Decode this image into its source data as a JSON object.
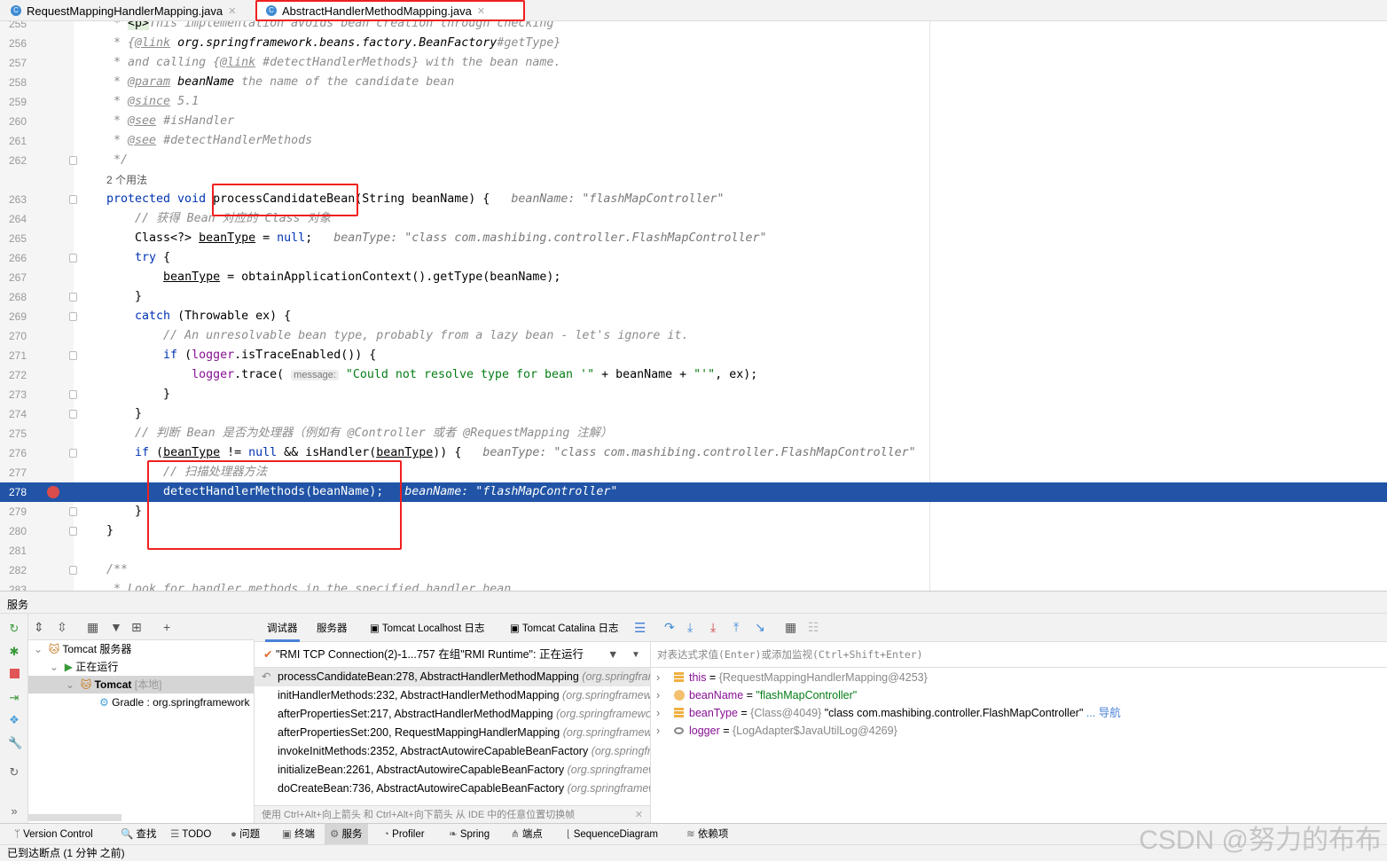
{
  "tabs": [
    {
      "label": "RequestMappingHandlerMapping.java",
      "active": false
    },
    {
      "label": "AbstractHandlerMethodMapping.java",
      "active": true
    }
  ],
  "editor": {
    "usages_hint": "2 个用法",
    "rows": [
      {
        "num": "255",
        "tokens": [
          [
            "cm",
            " * "
          ],
          [
            "green",
            "<p>"
          ],
          [
            "cm",
            "This implementation avoids bean creation through checking"
          ]
        ]
      },
      {
        "num": "256",
        "tokens": [
          [
            "cm",
            " * {"
          ],
          [
            "tag",
            "@link"
          ],
          [
            "dt",
            " org.springframework.beans.factory.BeanFactory"
          ],
          [
            "cm",
            "#getType}"
          ]
        ]
      },
      {
        "num": "257",
        "tokens": [
          [
            "cm",
            " * and calling {"
          ],
          [
            "tag",
            "@link"
          ],
          [
            "cm",
            " #detectHandlerMethods} with the bean name."
          ]
        ]
      },
      {
        "num": "258",
        "tokens": [
          [
            "cm",
            " * "
          ],
          [
            "tag",
            "@param"
          ],
          [
            "dt",
            " beanName"
          ],
          [
            "cm",
            " the name of the candidate bean"
          ]
        ]
      },
      {
        "num": "259",
        "tokens": [
          [
            "cm",
            " * "
          ],
          [
            "tag",
            "@since"
          ],
          [
            "cm",
            " 5.1"
          ]
        ]
      },
      {
        "num": "260",
        "tokens": [
          [
            "cm",
            " * "
          ],
          [
            "tag",
            "@see"
          ],
          [
            "cm",
            " #isHandler"
          ]
        ]
      },
      {
        "num": "261",
        "tokens": [
          [
            "cm",
            " * "
          ],
          [
            "tag",
            "@see"
          ],
          [
            "cm",
            " #detectHandlerMethods"
          ]
        ]
      },
      {
        "num": "262",
        "fold": true,
        "tokens": [
          [
            "cm",
            " */"
          ]
        ]
      },
      {
        "num": "",
        "usages": true,
        "tokens": [
          [
            "lbl",
            "2 个用法"
          ]
        ]
      },
      {
        "num": "263",
        "fold": true,
        "tokens": [
          [
            "kw",
            "protected void "
          ],
          [
            "pl",
            "processCandidateBean(String beanName) {"
          ]
        ],
        "hint": "beanName: \"flashMapController\""
      },
      {
        "num": "264",
        "tokens": [
          [
            "cm",
            "    // 获得 Bean 对应的 Class 对象"
          ]
        ]
      },
      {
        "num": "265",
        "tokens": [
          [
            "pl",
            "    Class<?> "
          ],
          [
            "ul",
            "beanType"
          ],
          [
            "pl",
            " = "
          ],
          [
            "kw",
            "null"
          ],
          [
            "pl",
            ";"
          ]
        ],
        "hint": "beanType: \"class com.mashibing.controller.FlashMapController\""
      },
      {
        "num": "266",
        "fold": true,
        "tokens": [
          [
            "kw",
            "    try"
          ],
          [
            "pl",
            " {"
          ]
        ]
      },
      {
        "num": "267",
        "tokens": [
          [
            "pl",
            "        "
          ],
          [
            "ul",
            "beanType"
          ],
          [
            "pl",
            " = obtainApplicationContext().getType(beanName);"
          ]
        ]
      },
      {
        "num": "268",
        "fold": true,
        "tokens": [
          [
            "pl",
            "    }"
          ]
        ]
      },
      {
        "num": "269",
        "fold": true,
        "tokens": [
          [
            "kw",
            "    catch"
          ],
          [
            "pl",
            " (Throwable ex) {"
          ]
        ]
      },
      {
        "num": "270",
        "tokens": [
          [
            "cm",
            "        // An unresolvable bean type, probably from a lazy bean - let's ignore it."
          ]
        ]
      },
      {
        "num": "271",
        "fold": true,
        "tokens": [
          [
            "kw",
            "        if"
          ],
          [
            "pl",
            " ("
          ],
          [
            "fld",
            "logger"
          ],
          [
            "pl",
            ".isTraceEnabled()) {"
          ]
        ]
      },
      {
        "num": "272",
        "tokens": [
          [
            "pl",
            "            "
          ],
          [
            "fld",
            "logger"
          ],
          [
            "pl",
            ".trace( "
          ],
          [
            "phint",
            "message:"
          ],
          [
            "str",
            " \"Could not resolve type for bean '\""
          ],
          [
            "pl",
            " + beanName + "
          ],
          [
            "str",
            "\"'\""
          ],
          [
            "pl",
            ", ex);"
          ]
        ]
      },
      {
        "num": "273",
        "fold": true,
        "tokens": [
          [
            "pl",
            "        }"
          ]
        ]
      },
      {
        "num": "274",
        "fold": true,
        "tokens": [
          [
            "pl",
            "    }"
          ]
        ]
      },
      {
        "num": "275",
        "tokens": [
          [
            "cm",
            "    // 判断 Bean 是否为处理器（例如有 @Controller 或者 @RequestMapping 注解）"
          ]
        ]
      },
      {
        "num": "276",
        "fold": true,
        "tokens": [
          [
            "kw",
            "    if"
          ],
          [
            "pl",
            " ("
          ],
          [
            "ul",
            "beanType"
          ],
          [
            "pl",
            " != "
          ],
          [
            "kw",
            "null"
          ],
          [
            "pl",
            " && isHandler("
          ],
          [
            "ul",
            "beanType"
          ],
          [
            "pl",
            ")) {"
          ]
        ],
        "hint": "beanType: \"class com.mashibing.controller.FlashMapController\""
      },
      {
        "num": "277",
        "tokens": [
          [
            "cm",
            "        // 扫描处理器方法"
          ]
        ]
      },
      {
        "num": "278",
        "highlight": true,
        "breakpoint": true,
        "tokens": [
          [
            "pl",
            "        detectHandlerMethods(beanName);"
          ]
        ],
        "hint": "beanName: \"flashMapController\""
      },
      {
        "num": "279",
        "fold": true,
        "tokens": [
          [
            "pl",
            "    }"
          ]
        ]
      },
      {
        "num": "280",
        "fold": true,
        "tokens": [
          [
            "pl",
            "}"
          ]
        ]
      },
      {
        "num": "281",
        "tokens": []
      },
      {
        "num": "282",
        "fold": true,
        "tokens": [
          [
            "cm",
            "/**"
          ]
        ]
      },
      {
        "num": "283",
        "tokens": [
          [
            "cm",
            " * Look for handler methods in the specified handler bean."
          ]
        ]
      }
    ]
  },
  "services": {
    "title": "服务",
    "tree": [
      {
        "label": "Tomcat 服务器",
        "icon": "tomcat-icon"
      },
      {
        "label": "正在运行",
        "icon": "run-icon"
      },
      {
        "label": "Tomcat",
        "suffix": "[本地]",
        "icon": "tomcat-icon"
      },
      {
        "label": "Gradle : org.springframework",
        "icon": "gradle-icon"
      }
    ]
  },
  "debugger": {
    "tabs": [
      "调试器",
      "服务器",
      "Tomcat Localhost 日志",
      "Tomcat Catalina 日志"
    ],
    "thread": "\"RMI TCP Connection(2)-1...757 在组\"RMI Runtime\": 正在运行",
    "frames": [
      {
        "method": "processCandidateBean:278, AbstractHandlerMethodMapping",
        "pkg": "(org.springframework.web.servlet.handler)"
      },
      {
        "method": "initHandlerMethods:232, AbstractHandlerMethodMapping",
        "pkg": "(org.springframework.web.servlet.handler)"
      },
      {
        "method": "afterPropertiesSet:217, AbstractHandlerMethodMapping",
        "pkg": "(org.springframework.web.servlet.handler)"
      },
      {
        "method": "afterPropertiesSet:200, RequestMappingHandlerMapping",
        "pkg": "(org.springframework.web.servlet.mvc)"
      },
      {
        "method": "invokeInitMethods:2352, AbstractAutowireCapableBeanFactory",
        "pkg": "(org.springframework.beans)"
      },
      {
        "method": "initializeBean:2261, AbstractAutowireCapableBeanFactory",
        "pkg": "(org.springframework.beans)"
      },
      {
        "method": "doCreateBean:736, AbstractAutowireCapableBeanFactory",
        "pkg": "(org.springframework.beans)"
      }
    ],
    "frames_hint": "使用 Ctrl+Alt+向上箭头 和 Ctrl+Alt+向下箭头 从 IDE 中的任意位置切换帧",
    "eval_placeholder": "对表达式求值(Enter)或添加监视(Ctrl+Shift+Enter)",
    "variables": [
      {
        "name": "this",
        "eq": " = ",
        "value": "{RequestMappingHandlerMapping@4253}",
        "icon": "field-icon"
      },
      {
        "name": "beanName",
        "eq": " = ",
        "string": "\"flashMapController\"",
        "icon": "param-icon"
      },
      {
        "name": "beanType",
        "eq": " = ",
        "value": "{Class@4049} ",
        "string2": "\"class com.mashibing.controller.FlashMapController\"",
        "more": " ... 导航",
        "icon": "field-icon"
      },
      {
        "name": "logger",
        "eq": " = ",
        "value": "{LogAdapter$JavaUtilLog@4269}",
        "icon": "watch-icon"
      }
    ]
  },
  "bottombar": [
    "Version Control",
    "查找",
    "TODO",
    "问题",
    "终端",
    "服务",
    "Profiler",
    "Spring",
    "端点",
    "SequenceDiagram",
    "依赖项"
  ],
  "status": "已到达断点 (1 分钟 之前)",
  "watermark": "CSDN @努力的布布",
  "colors": {
    "highlight": "#2154a6",
    "keyword": "#0033b3",
    "string": "#067d17",
    "annotation_box": "#f02020"
  }
}
